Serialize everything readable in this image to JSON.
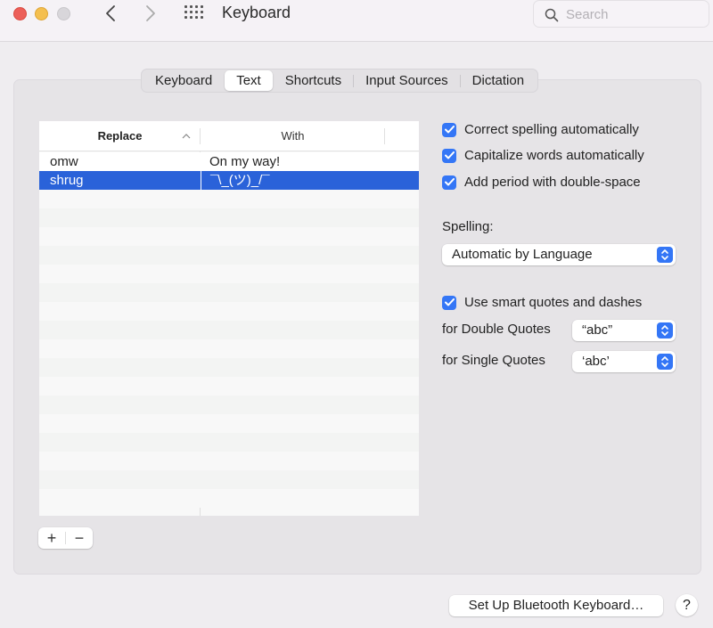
{
  "window": {
    "title": "Keyboard",
    "search_placeholder": "Search"
  },
  "tabs": [
    {
      "label": "Keyboard",
      "active": false
    },
    {
      "label": "Text",
      "active": true
    },
    {
      "label": "Shortcuts",
      "active": false
    },
    {
      "label": "Input Sources",
      "active": false
    },
    {
      "label": "Dictation",
      "active": false
    }
  ],
  "table": {
    "columns": {
      "replace": "Replace",
      "with": "With"
    },
    "sort": "ascending",
    "rows": [
      {
        "replace": "omw",
        "with": "On my way!",
        "selected": false
      },
      {
        "replace": "shrug",
        "with": "¯\\_(ツ)_/¯",
        "selected": true
      }
    ],
    "add_label": "+",
    "remove_label": "−"
  },
  "options": {
    "correct_spelling": {
      "label": "Correct spelling automatically",
      "checked": true
    },
    "capitalize_words": {
      "label": "Capitalize words automatically",
      "checked": true
    },
    "add_period": {
      "label": "Add period with double-space",
      "checked": true
    },
    "spelling_label": "Spelling:",
    "spelling_value": "Automatic by Language",
    "smart_quotes": {
      "label": "Use smart quotes and dashes",
      "checked": true
    },
    "double_quotes_label": "for Double Quotes",
    "double_quotes_value": "“abc”",
    "single_quotes_label": "for Single Quotes",
    "single_quotes_value": "‘abc’"
  },
  "footer": {
    "bluetooth_button": "Set Up Bluetooth Keyboard…",
    "help_button": "?"
  },
  "colors": {
    "accent": "#3476f6",
    "selection": "#2a62d9"
  }
}
